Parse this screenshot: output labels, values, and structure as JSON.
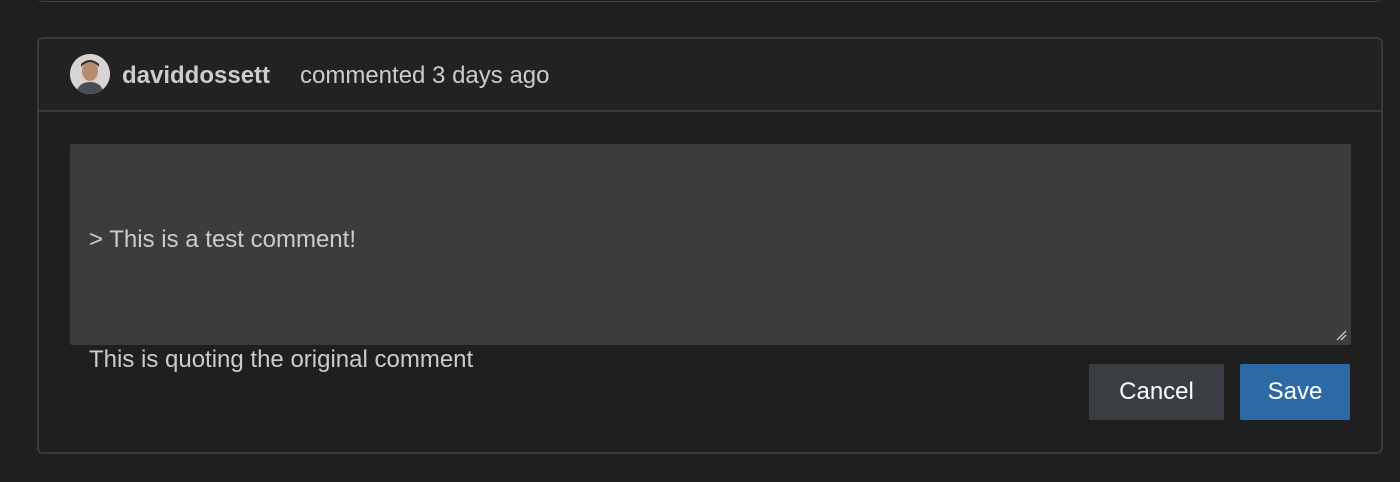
{
  "comment": {
    "author": "daviddossett",
    "meta": "commented 3 days ago",
    "avatar_icon": "user-avatar"
  },
  "editor": {
    "line1": "> This is a test comment!",
    "line2": "This is quoting the original comment"
  },
  "actions": {
    "cancel_label": "Cancel",
    "save_label": "Save"
  },
  "colors": {
    "background": "#1f1f1f",
    "editor_bg": "#3c3c3c",
    "primary_button": "#2b6aa5",
    "secondary_button": "#3a3d41",
    "text": "#cccccc"
  }
}
